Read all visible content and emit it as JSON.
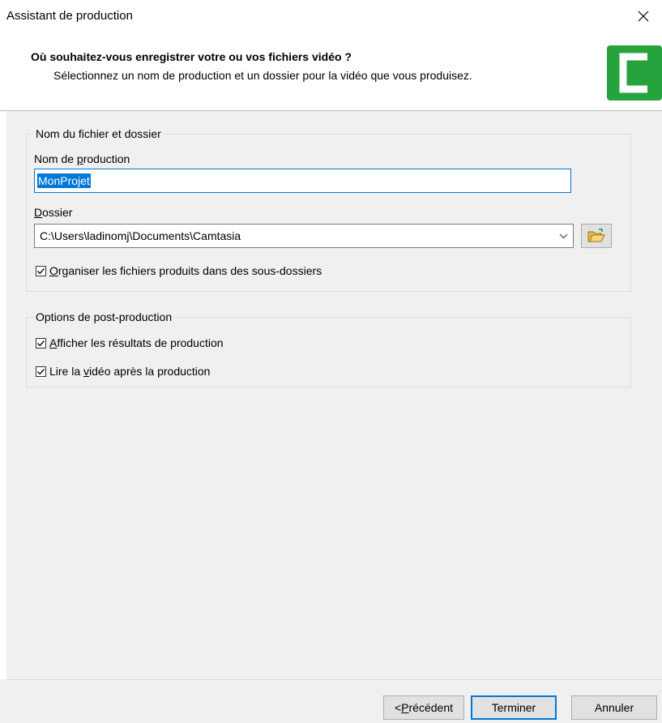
{
  "window": {
    "title": "Assistant de production",
    "close_icon": "close-icon"
  },
  "header": {
    "title": "Où souhaitez-vous enregistrer votre ou vos fichiers vidéo ?",
    "subtitle": "Sélectionnez un nom de production et un dossier pour la vidéo que vous produisez.",
    "logo_color": "#27a33e"
  },
  "file_group": {
    "legend": "Nom du fichier et dossier",
    "name_label_pre": "Nom de ",
    "name_label_key": "p",
    "name_label_post": "roduction",
    "name_value": "MonProjet",
    "folder_label_key": "D",
    "folder_label_post": "ossier",
    "folder_value": "C:\\Users\\ladinomj\\Documents\\Camtasia",
    "organize_key": "O",
    "organize_label": "rganiser les fichiers produits dans des sous-dossiers",
    "organize_checked": true
  },
  "post_group": {
    "legend": "Options de post-production",
    "show_results_key": "A",
    "show_results_label": "fficher les résultats de production",
    "show_results_checked": true,
    "play_video_pre": "Lire la ",
    "play_video_key": "v",
    "play_video_post": "idéo après la production",
    "play_video_checked": true
  },
  "footer": {
    "prev_pre": "< ",
    "prev_key": "P",
    "prev_post": "récédent",
    "finish_label": "Terminer",
    "cancel_label": "Annuler"
  },
  "colors": {
    "accent": "#0078d7",
    "panel_bg": "#f0f0f0",
    "logo": "#27a33e"
  }
}
